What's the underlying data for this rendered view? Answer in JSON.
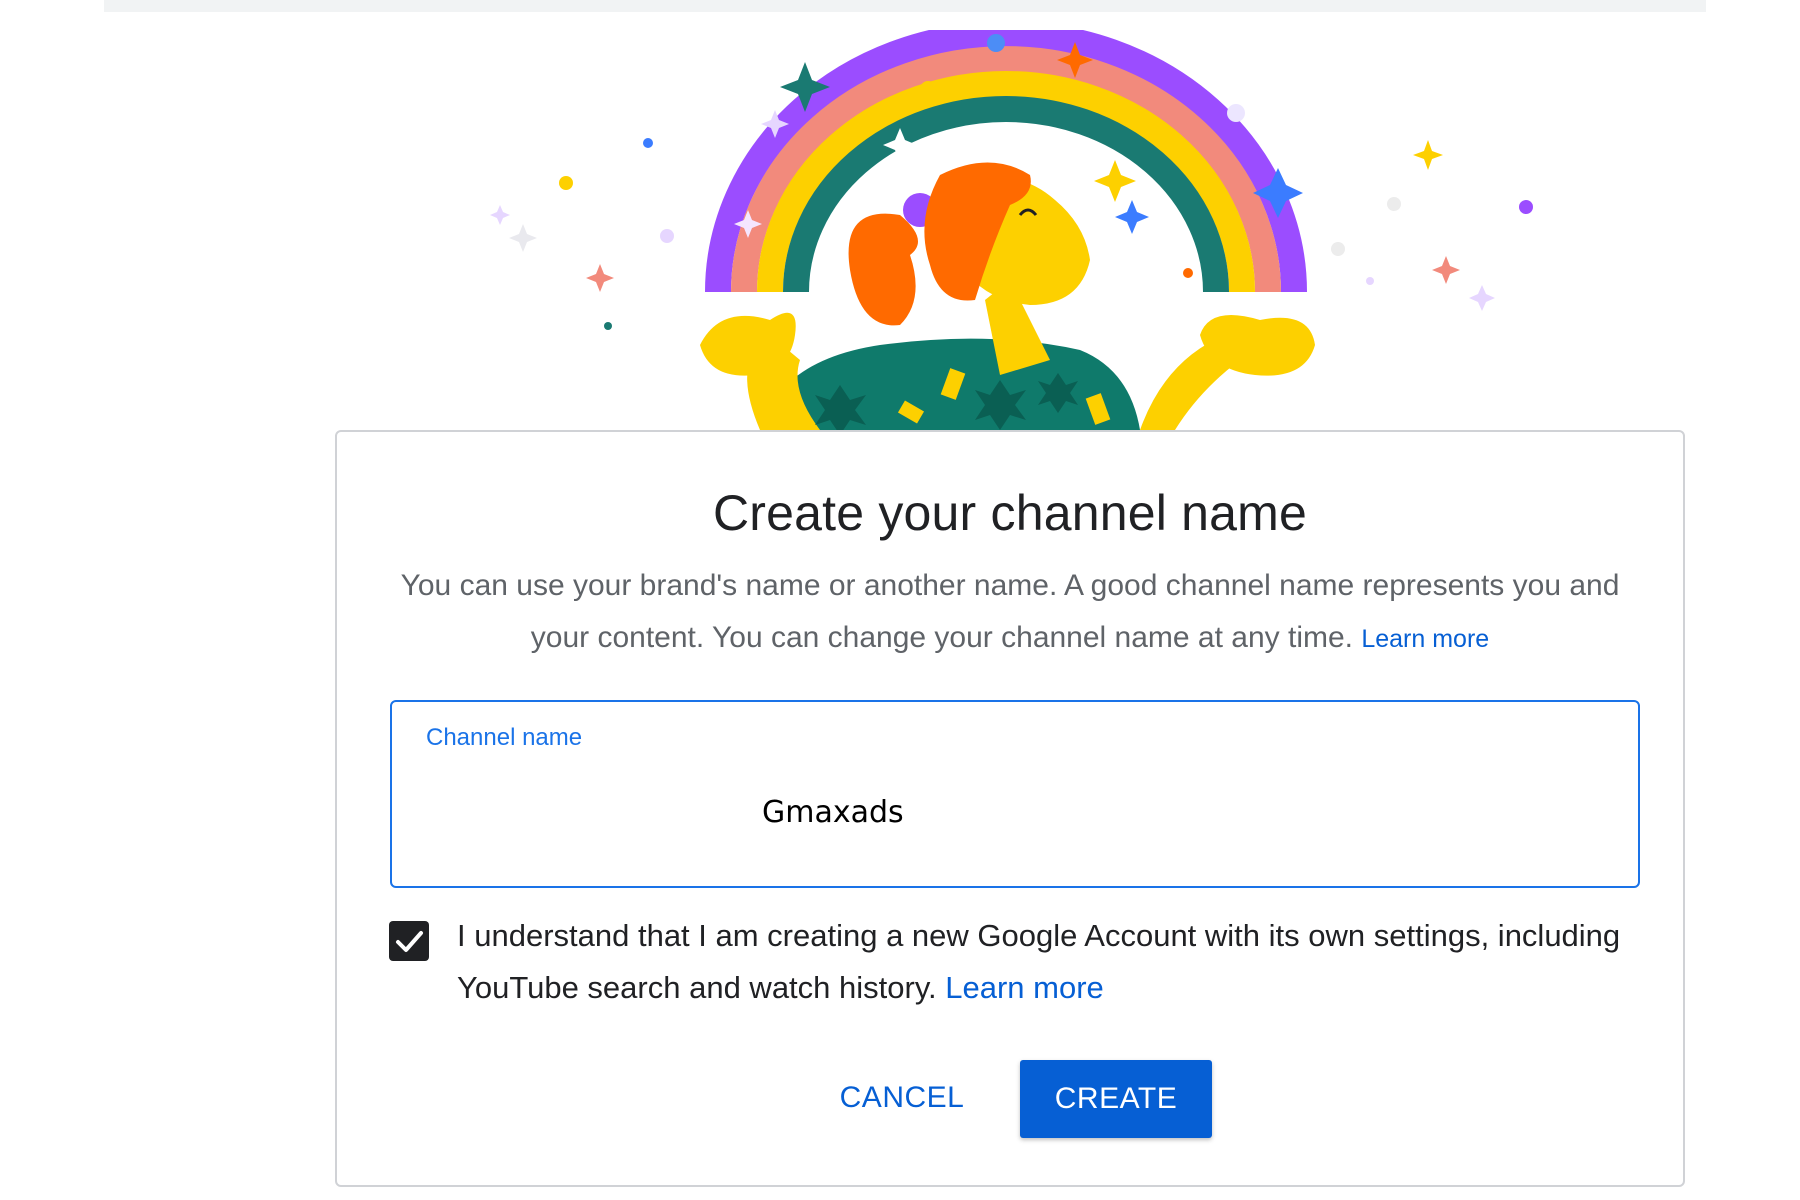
{
  "dialog": {
    "title": "Create your channel name",
    "description": "You can use your brand's name or another name. A good channel name represents you and your content. You can change your channel name at any time.",
    "description_link": "Learn more",
    "field_label": "Channel name",
    "field_value": "Gmaxads",
    "checkbox_checked": true,
    "consent_text": "I understand that I am creating a new Google Account with its own settings, including YouTube search and watch history.",
    "consent_link": "Learn more",
    "cancel_label": "CANCEL",
    "create_label": "CREATE"
  },
  "colors": {
    "accent": "#065fd4",
    "field_border": "#1a73e8",
    "rainbow": [
      "#9b4dff",
      "#f28a7c",
      "#fdd000",
      "#1a7a72"
    ]
  },
  "illustration": {
    "icon": "rainbow-person-illustration"
  }
}
